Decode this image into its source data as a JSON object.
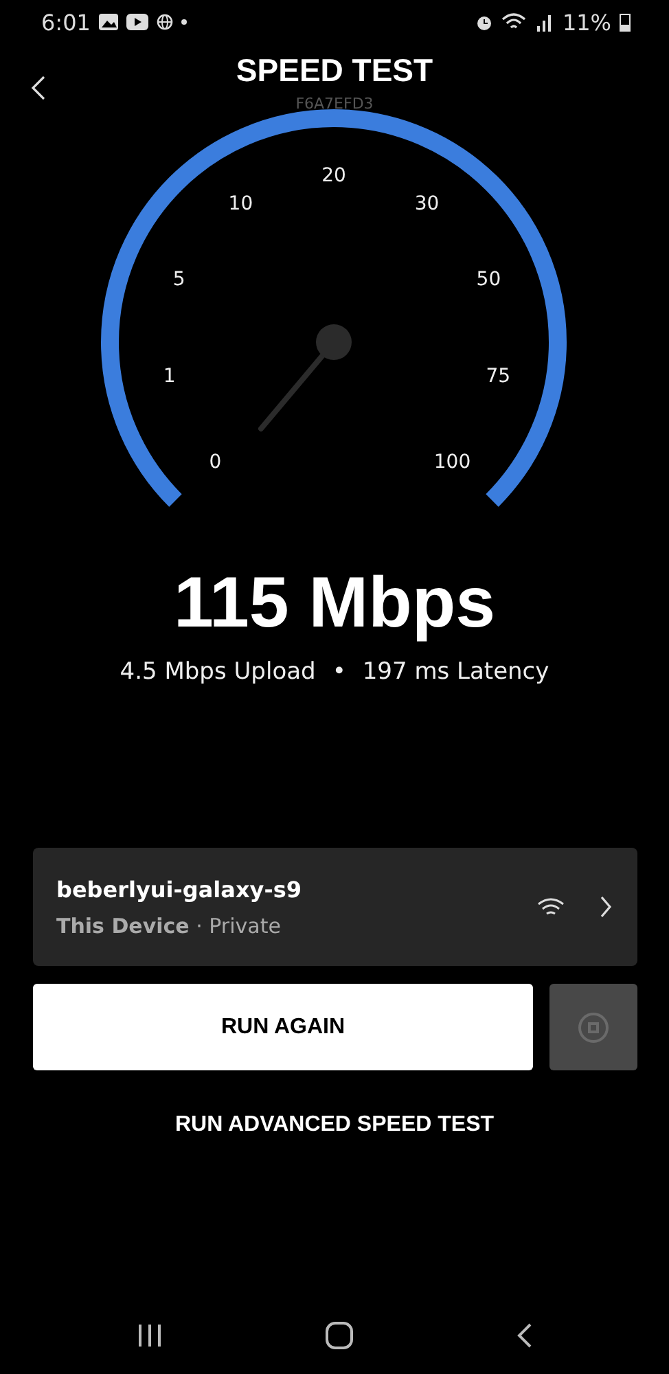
{
  "status_bar": {
    "time": "6:01",
    "battery": "11%"
  },
  "header": {
    "title": "SPEED TEST",
    "subtitle": "F6A7EFD3"
  },
  "gauge": {
    "scale": [
      "0",
      "1",
      "5",
      "10",
      "20",
      "30",
      "50",
      "75",
      "100"
    ]
  },
  "result": {
    "speed": "115 Mbps",
    "upload": "4.5 Mbps Upload",
    "separator": "•",
    "latency": "197 ms Latency"
  },
  "device": {
    "name": "beberlyui-galaxy-s9",
    "label": "This Device",
    "detail": "· Private"
  },
  "buttons": {
    "primary": "RUN AGAIN",
    "advanced": "RUN ADVANCED SPEED TEST"
  }
}
